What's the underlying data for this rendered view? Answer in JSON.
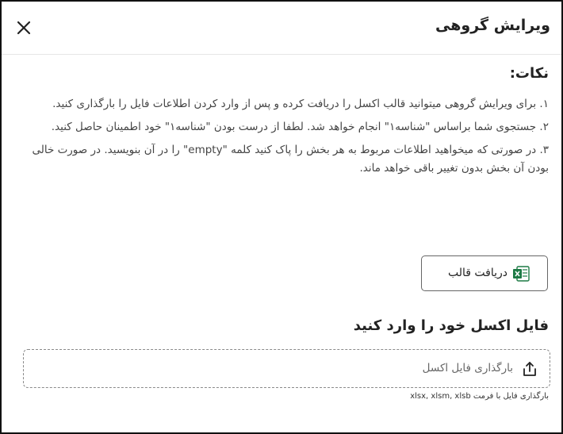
{
  "dialog": {
    "title": "ویرایش گروهی",
    "close_icon": "close-icon"
  },
  "notes": {
    "title": "نکات:",
    "items": [
      "۱. برای ویرایش گروهی میتوانید قالب اکسل را دریافت کرده و پس از وارد کردن اطلاعات فایل را بارگذاری کنید.",
      "۲. جستجوی شما براساس \"شناسه۱\" انجام خواهد شد. لطفا از درست بودن \"شناسه۱\" خود اطمینان حاصل کنید.",
      "۳. در صورتی که میخواهید اطلاعات مربوط به هر بخش را پاک کنید کلمه \"empty\" را در آن بنویسید. در صورت خالی بودن آن بخش بدون تغییر باقی خواهد ماند."
    ]
  },
  "template_button": {
    "label": "دریافت قالب",
    "icon": "excel-icon",
    "icon_color": "#1d7a45"
  },
  "upload": {
    "title": "فایل اکسل خود را وارد کنید",
    "dropzone_label": "بارگذاری فایل اکسل",
    "icon": "upload-icon",
    "hint": "بارگذاری فایل با فرمت xlsx, xlsm, xlsb"
  }
}
